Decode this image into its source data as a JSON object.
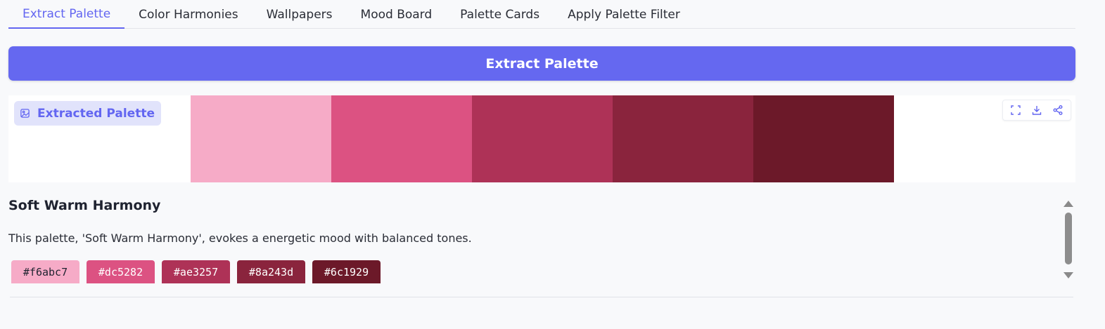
{
  "tabs": [
    {
      "label": "Extract Palette",
      "active": true
    },
    {
      "label": "Color Harmonies",
      "active": false
    },
    {
      "label": "Wallpapers",
      "active": false
    },
    {
      "label": "Mood Board",
      "active": false
    },
    {
      "label": "Palette Cards",
      "active": false
    },
    {
      "label": "Apply Palette Filter",
      "active": false
    }
  ],
  "extract_button": {
    "label": "Extract Palette"
  },
  "preview": {
    "badge_label": "Extracted Palette",
    "badge_icon": "image-icon",
    "toolbar_icons": [
      "fullscreen-icon",
      "download-icon",
      "share-icon"
    ]
  },
  "palette": {
    "name": "Soft Warm Harmony",
    "description": "This palette, 'Soft Warm Harmony', evokes a energetic mood with balanced tones.",
    "colors": [
      {
        "hex": "#f6abc7",
        "text_color": "#1f2330"
      },
      {
        "hex": "#dc5282",
        "text_color": "#ffffff"
      },
      {
        "hex": "#ae3257",
        "text_color": "#ffffff"
      },
      {
        "hex": "#8a243d",
        "text_color": "#ffffff"
      },
      {
        "hex": "#6c1929",
        "text_color": "#ffffff"
      }
    ]
  },
  "accent_color": "#6366f1"
}
